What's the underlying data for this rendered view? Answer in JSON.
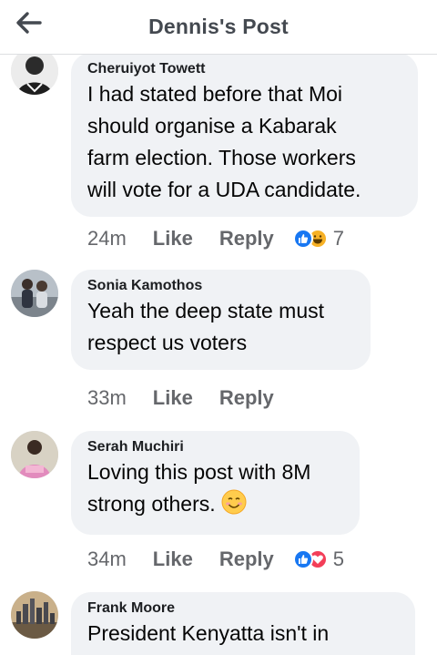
{
  "header": {
    "title": "Dennis's Post",
    "back_icon": "arrow-left-icon"
  },
  "comments": [
    {
      "author": "Cheruiyot Towett",
      "lines": [
        "I had stated before that Moi",
        "should organise a Kabarak",
        "farm election. Those workers",
        "will vote for a UDA candidate."
      ],
      "time": "24m",
      "like": "Like",
      "reply": "Reply",
      "reactions": [
        "like",
        "haha"
      ],
      "reaction_count": "7"
    },
    {
      "author": "Sonia Kamothos",
      "lines": [
        "Yeah the deep state must",
        "respect us voters"
      ],
      "time": "33m",
      "like": "Like",
      "reply": "Reply"
    },
    {
      "author": "Serah Muchiri",
      "lines": [
        "Loving this post with 8M",
        "strong others."
      ],
      "emoji": "smiling-face",
      "time": "34m",
      "like": "Like",
      "reply": "Reply",
      "reactions": [
        "like",
        "love"
      ],
      "reaction_count": "5"
    },
    {
      "author": "Frank Moore",
      "lines": [
        "President Kenyatta isn't in"
      ]
    }
  ],
  "colors": {
    "like_blue": "#1877f2",
    "love_red": "#f33e58",
    "haha_yellow": "#f7b125",
    "bubble": "#f0f2f5",
    "meta_gray": "#65676b"
  }
}
